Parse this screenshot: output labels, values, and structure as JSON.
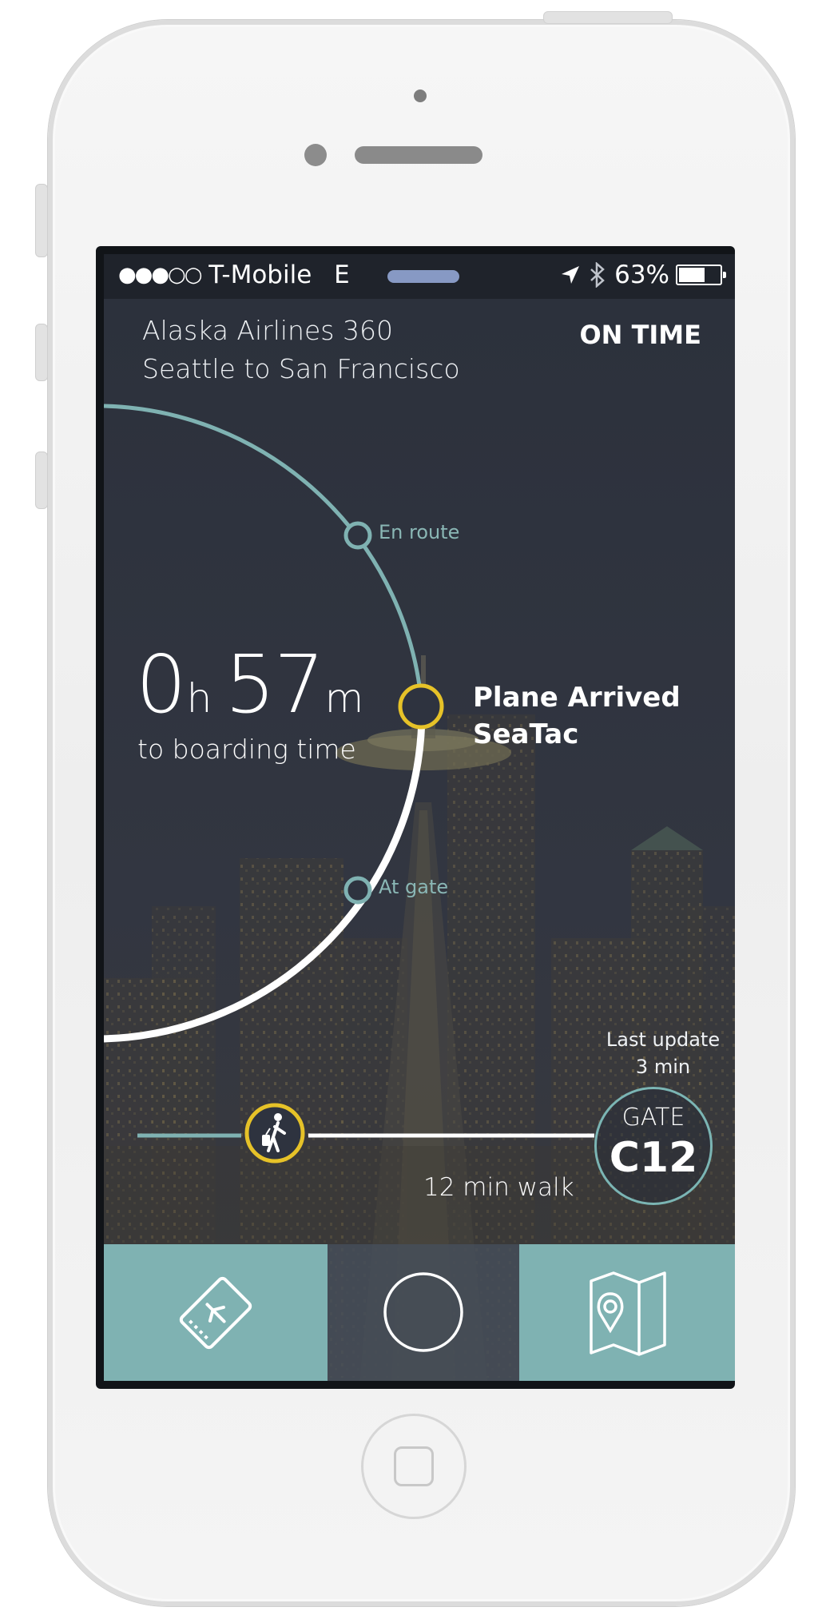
{
  "status_bar": {
    "signal": "●●●○○",
    "carrier": "T-Mobile",
    "network": "E",
    "battery_text": "63%",
    "battery_level": 0.63,
    "icons": [
      "location-arrow-icon",
      "bluetooth-icon",
      "battery-icon"
    ]
  },
  "flight": {
    "name": "Alaska Airlines 360",
    "route": "Seattle to San Francisco",
    "status": "ON TIME"
  },
  "countdown": {
    "hours": "0",
    "hours_unit": "h",
    "minutes": "57",
    "minutes_unit": "m",
    "label": "to boarding time"
  },
  "timeline": {
    "milestones": [
      {
        "label": "En route"
      },
      {
        "label": "At gate"
      }
    ],
    "current_status_line1": "Plane Arrived",
    "current_status_line2": "SeaTac"
  },
  "gate": {
    "last_update_label": "Last update",
    "last_update_value": "3 min",
    "gate_label": "GATE",
    "gate_value": "C12",
    "walk_label": "12 min walk"
  },
  "tab_bar": {
    "tabs": [
      {
        "icon": "boarding-pass-icon"
      },
      {
        "icon": "circle-icon"
      },
      {
        "icon": "map-pin-icon"
      }
    ]
  },
  "colors": {
    "accent_teal": "#7fb2b2",
    "accent_yellow": "#e6c228",
    "background": "#2e333f"
  }
}
